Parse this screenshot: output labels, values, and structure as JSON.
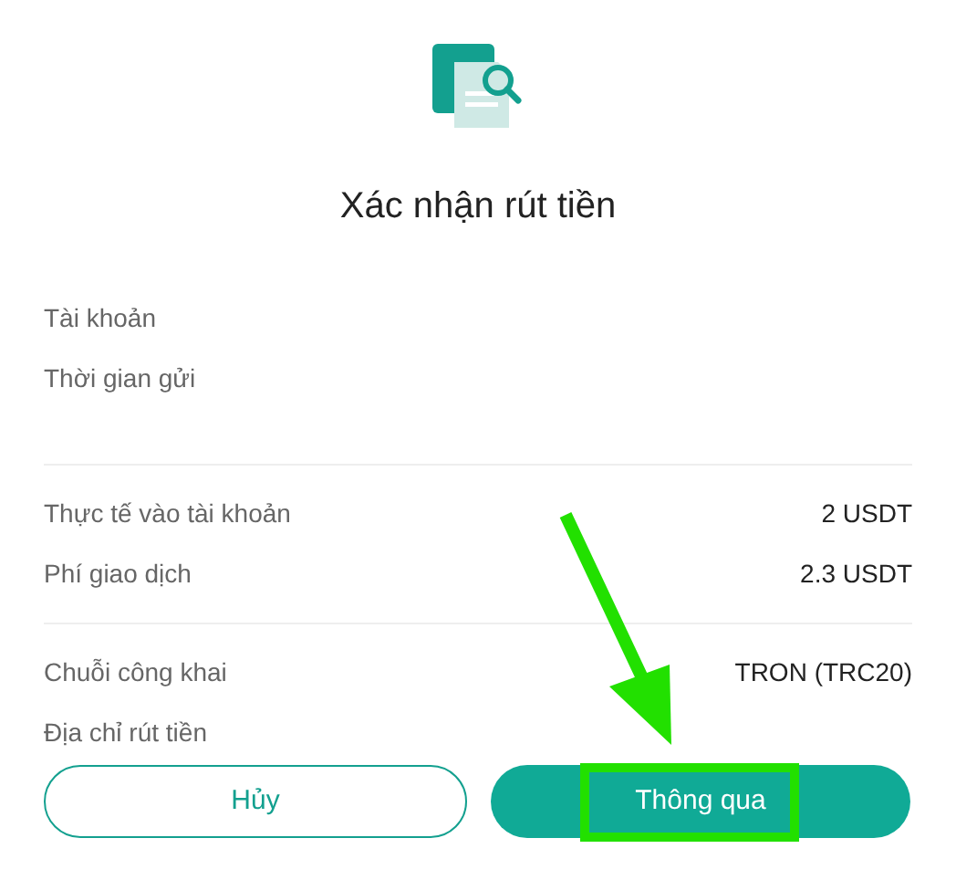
{
  "dialog": {
    "title": "Xác nhận rút tiền"
  },
  "sections": [
    {
      "rows": [
        {
          "label": "Tài khoản"
        },
        {
          "label": "Thời gian gửi"
        }
      ]
    },
    {
      "rows": [
        {
          "label": "Thực tế vào tài khoản",
          "value": "2 USDT"
        },
        {
          "label": "Phí giao dịch",
          "value": "2.3 USDT"
        }
      ]
    },
    {
      "rows": [
        {
          "label": "Chuỗi công khai",
          "value": "TRON (TRC20)"
        },
        {
          "label": "Địa chỉ rút tiền"
        }
      ]
    }
  ],
  "buttons": [
    {
      "kind": "secondary",
      "label": "Hủy"
    },
    {
      "kind": "primary",
      "label": "Thông qua"
    }
  ]
}
